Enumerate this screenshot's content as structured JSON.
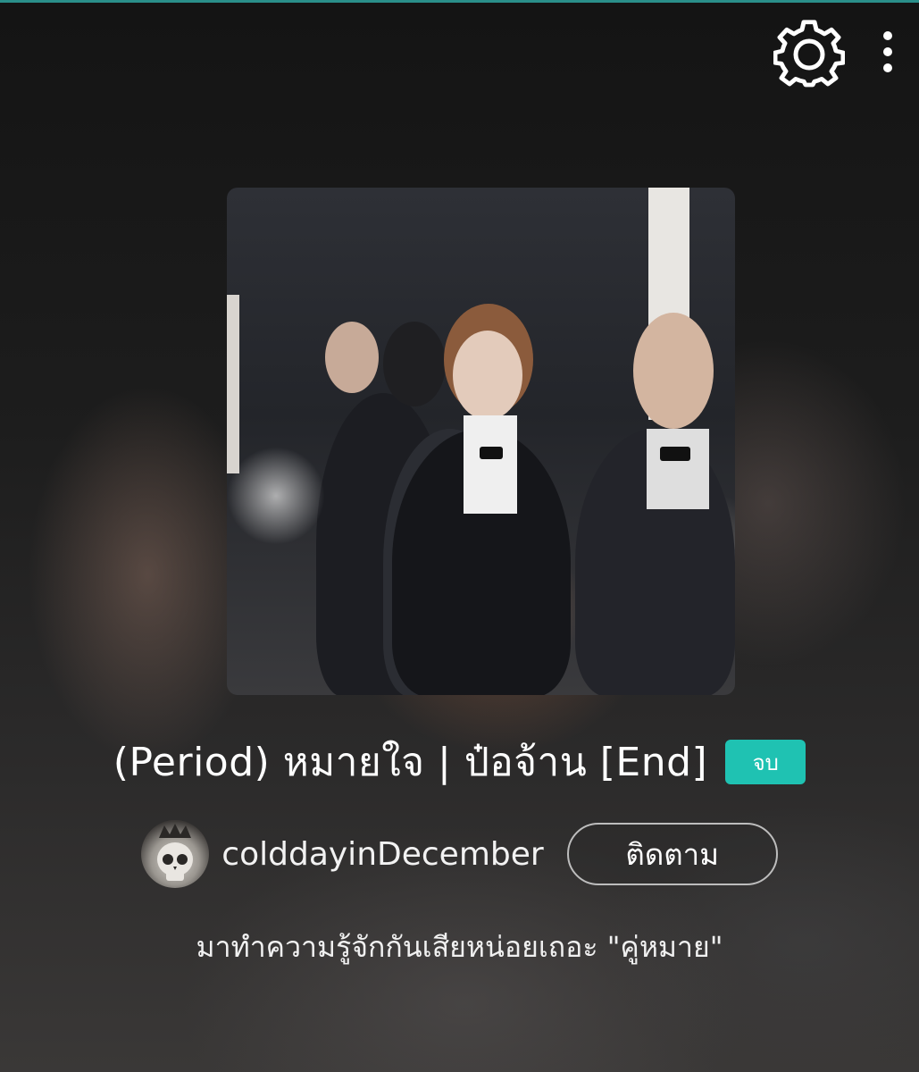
{
  "toolbar": {
    "settings_icon": "gear-icon",
    "more_icon": "more-vertical-icon"
  },
  "story": {
    "title": "(Period) หมายใจ | ป๋อจ้าน [End]",
    "status_badge": "จบ",
    "tagline": "มาทำความรู้จักกันเสียหน่อยเถอะ \"คู่หมาย\""
  },
  "author": {
    "name": "colddayinDecember",
    "follow_label": "ติดตาม"
  },
  "colors": {
    "accent": "#1fc2b2",
    "top_rule": "#2a8f8a",
    "background": "#191919",
    "text": "#ffffff"
  }
}
